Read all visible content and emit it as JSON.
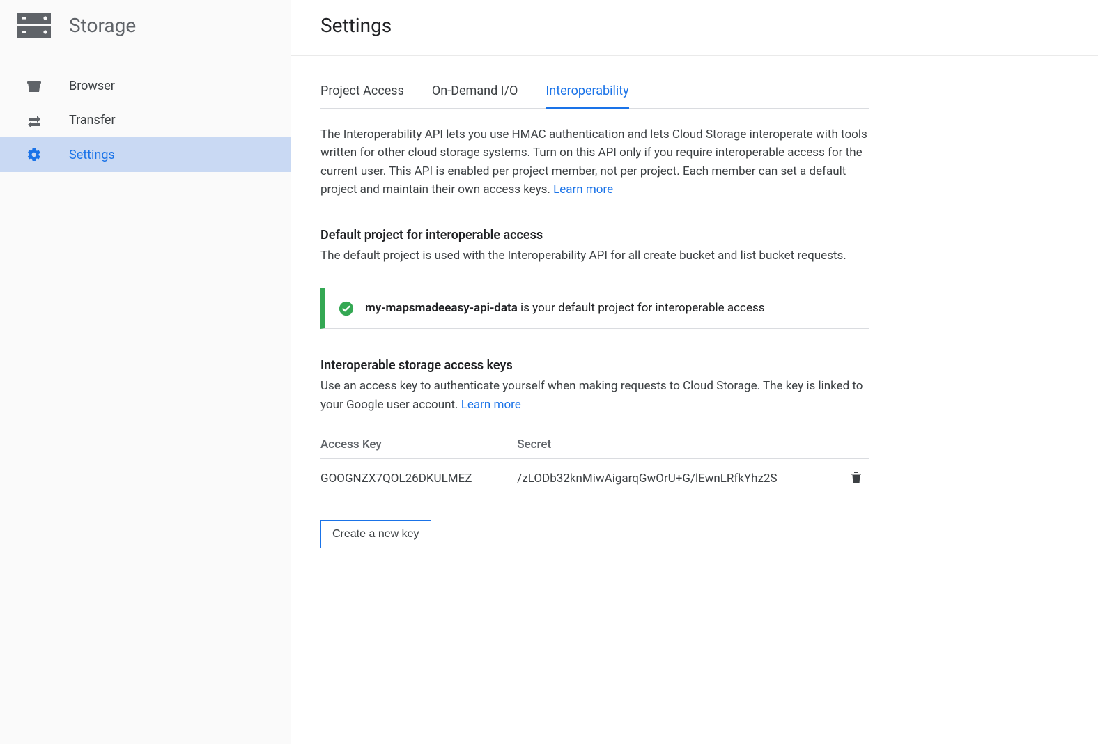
{
  "sidebar": {
    "title": "Storage",
    "items": [
      {
        "label": "Browser",
        "icon": "bucket-icon"
      },
      {
        "label": "Transfer",
        "icon": "transfer-icon"
      },
      {
        "label": "Settings",
        "icon": "gear-icon"
      }
    ],
    "active_index": 2
  },
  "header": {
    "title": "Settings"
  },
  "tabs": [
    {
      "label": "Project Access"
    },
    {
      "label": "On-Demand I/O"
    },
    {
      "label": "Interoperability"
    }
  ],
  "active_tab_index": 2,
  "intro_text": "The Interoperability API lets you use HMAC authentication and lets Cloud Storage interoperate with tools written for other cloud storage systems. Turn on this API only if you require interoperable access for the current user. This API is enabled per project member, not per project. Each member can set a default project and maintain their own access keys. ",
  "intro_link": "Learn more",
  "default_project": {
    "heading": "Default project for interoperable access",
    "description": "The default project is used with the Interoperability API for all create bucket and list bucket requests.",
    "notice_bold": "my-mapsmadeeasy-api-data",
    "notice_rest": " is your default project for interoperable access"
  },
  "access_keys": {
    "heading": "Interoperable storage access keys",
    "description_before": "Use an access key to authenticate yourself when making requests to Cloud Storage. The key is linked to your Google user account. ",
    "description_link": "Learn more",
    "columns": {
      "c1": "Access Key",
      "c2": "Secret"
    },
    "rows": [
      {
        "key": "GOOGNZX7QOL26DKULMEZ",
        "secret": "/zLODb32knMiwAigarqGwOrU+G/lEwnLRfkYhz2S"
      }
    ]
  },
  "create_button": "Create a new key"
}
